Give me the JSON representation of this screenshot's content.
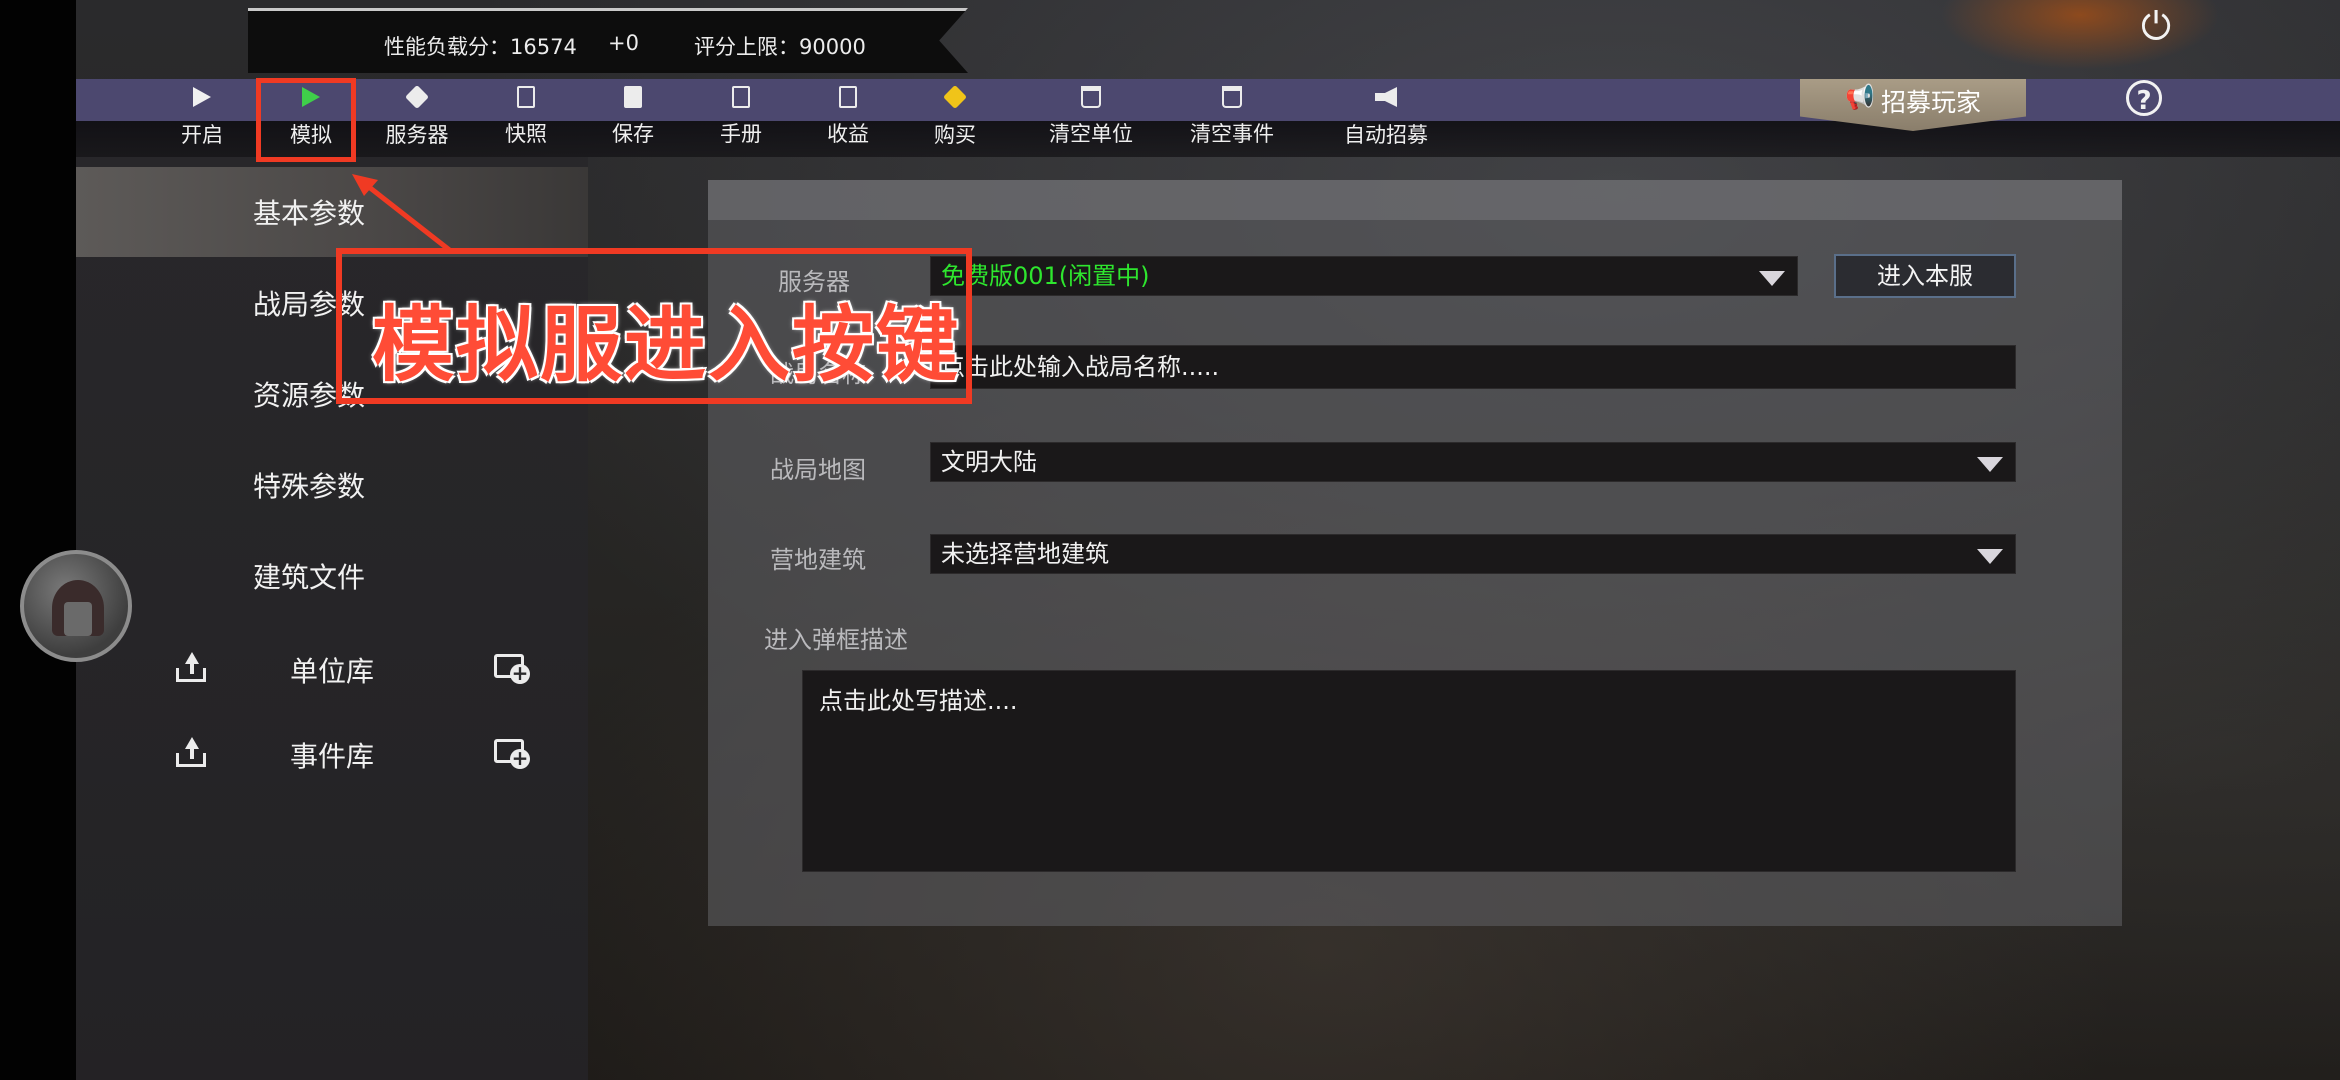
{
  "stats": {
    "perf_load": "性能负载分：16574",
    "delta": "+0",
    "score_cap": "评分上限：90000"
  },
  "toolbar": {
    "items": [
      {
        "label": "开启",
        "icon": "play-icon"
      },
      {
        "label": "模拟",
        "icon": "play-green-icon"
      },
      {
        "label": "服务器",
        "icon": "cube-icon"
      },
      {
        "label": "快照",
        "icon": "edit-icon"
      },
      {
        "label": "保存",
        "icon": "document-icon"
      },
      {
        "label": "手册",
        "icon": "edit-icon"
      },
      {
        "label": "收益",
        "icon": "edit-icon"
      },
      {
        "label": "购买",
        "icon": "cube-yellow-icon"
      },
      {
        "label": "清空单位",
        "icon": "trash-icon"
      },
      {
        "label": "清空事件",
        "icon": "trash-icon"
      },
      {
        "label": "自动招募",
        "icon": "megaphone-icon"
      }
    ],
    "recruit_label": "招募玩家",
    "help_label": "?",
    "power_icon": "power-icon"
  },
  "sidebar": {
    "items": [
      {
        "label": "基本参数",
        "active": true
      },
      {
        "label": "战局参数"
      },
      {
        "label": "资源参数"
      },
      {
        "label": "特殊参数"
      },
      {
        "label": "建筑文件"
      }
    ],
    "libraries": [
      {
        "label": "单位库"
      },
      {
        "label": "事件库"
      }
    ]
  },
  "form": {
    "server_label": "服务器",
    "server_value": "免费版001(闲置中)",
    "server_value_color": "#2ee62e",
    "enter_button": "进入本服",
    "name_label": "战局名称",
    "name_placeholder": "点击此处输入战局名称.....",
    "map_label": "战局地图",
    "map_value": "文明大陆",
    "camp_label": "营地建筑",
    "camp_value": "未选择营地建筑",
    "desc_label": "进入弹框描述",
    "desc_placeholder": "点击此处写描述...."
  },
  "annotation": {
    "text": "模拟服进入按键",
    "color": "#f03a23"
  }
}
